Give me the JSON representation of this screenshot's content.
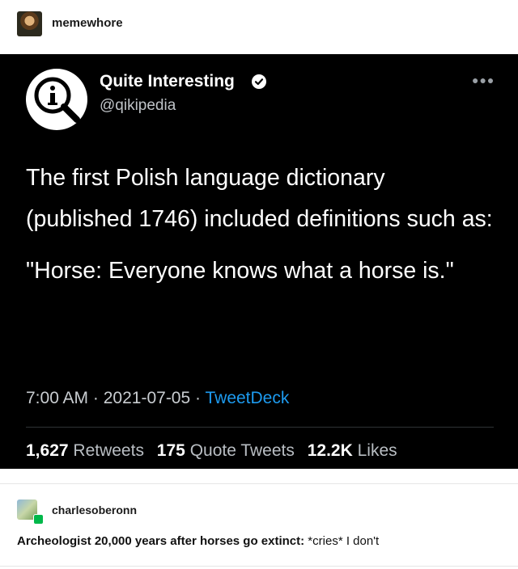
{
  "post": {
    "author": "memewhore"
  },
  "tweet": {
    "account_name": "Quite Interesting",
    "handle": "@qikipedia",
    "paragraphs": [
      "The first Polish language dictionary (published 1746) included definitions such as:",
      "\"Horse: Everyone knows what a horse is.\""
    ],
    "time": "7:00 AM",
    "date": "2021-07-05",
    "separator": "·",
    "source": "TweetDeck",
    "stats": {
      "retweets_count": "1,627",
      "retweets_label": "Retweets",
      "quotes_count": "175",
      "quotes_label": "Quote Tweets",
      "likes_count": "12.2K",
      "likes_label": "Likes"
    },
    "colors": {
      "background": "#000000",
      "link": "#1d9bf0"
    }
  },
  "reblog": {
    "author": "charlesoberonn",
    "text_bold": "Archeologist 20,000 years after horses go extinct:",
    "text_rest": " *cries* I don't"
  }
}
